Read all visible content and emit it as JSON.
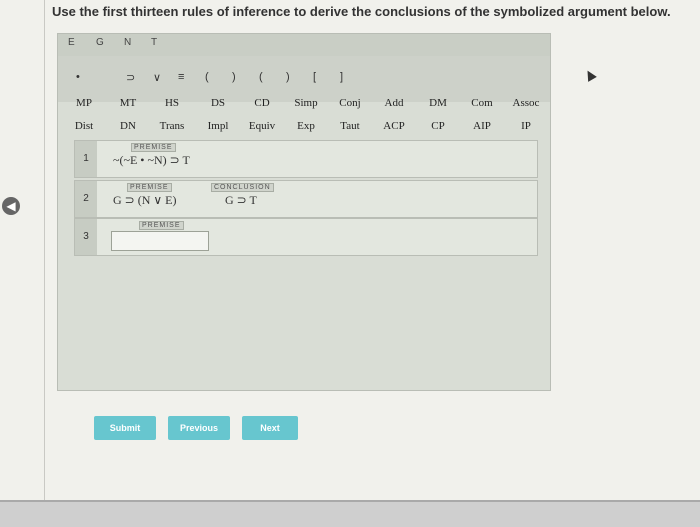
{
  "question": "Use the first thirteen rules of inference to derive the conclusions of the symbolized argument below.",
  "top_tabs": [
    "E",
    "G",
    "N",
    "T"
  ],
  "symbols": [
    "•",
    "⊃",
    "∨",
    "≡",
    "(",
    ")",
    "(",
    ")",
    "[",
    "]"
  ],
  "rules_row1": [
    "MP",
    "MT",
    "HS",
    "DS",
    "CD",
    "Simp",
    "Conj",
    "Add",
    "DM",
    "Com",
    "Assoc"
  ],
  "rules_row2": [
    "Dist",
    "DN",
    "Trans",
    "Impl",
    "Equiv",
    "Exp",
    "Taut",
    "ACP",
    "CP",
    "AIP",
    "IP"
  ],
  "lines": [
    {
      "num": "1",
      "tag": "PREMISE",
      "formula": "~(~E • ~N) ⊃ T"
    },
    {
      "num": "2",
      "tag": "PREMISE",
      "formula": "G ⊃ (N ∨ E)",
      "conclusion_tag": "CONCLUSION",
      "conclusion": "G ⊃ T"
    },
    {
      "num": "3",
      "tag": "PREMISE",
      "formula": ""
    }
  ],
  "buttons": {
    "submit": "Submit",
    "previous": "Previous",
    "next": "Next"
  }
}
